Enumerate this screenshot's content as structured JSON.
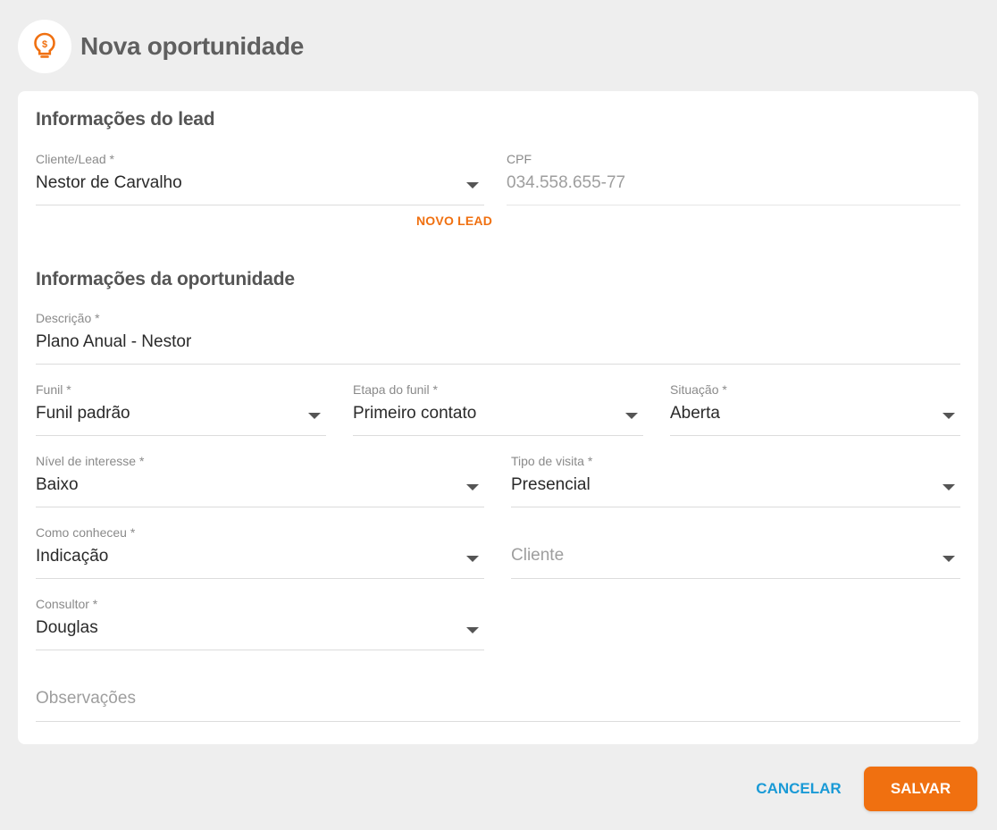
{
  "header": {
    "title": "Nova oportunidade",
    "icon": "lightbulb-dollar-icon",
    "accent_color": "#f07010"
  },
  "lead_section": {
    "title": "Informações do lead",
    "cliente": {
      "label": "Cliente/Lead *",
      "value": "Nestor de Carvalho"
    },
    "cpf": {
      "label": "CPF",
      "value": "034.558.655-77"
    },
    "novo_lead_label": "NOVO LEAD"
  },
  "opportunity_section": {
    "title": "Informações da oportunidade",
    "descricao": {
      "label": "Descrição *",
      "value": "Plano Anual - Nestor"
    },
    "funil": {
      "label": "Funil *",
      "value": "Funil padrão"
    },
    "etapa": {
      "label": "Etapa do funil *",
      "value": "Primeiro contato"
    },
    "situacao": {
      "label": "Situação *",
      "value": "Aberta"
    },
    "nivel_interesse": {
      "label": "Nível de interesse *",
      "value": "Baixo"
    },
    "tipo_visita": {
      "label": "Tipo de visita *",
      "value": "Presencial"
    },
    "como_conheceu": {
      "label": "Como conheceu *",
      "value": "Indicação"
    },
    "cliente_indicador": {
      "placeholder": "Cliente"
    },
    "consultor": {
      "label": "Consultor *",
      "value": "Douglas"
    },
    "observacoes": {
      "placeholder": "Observações"
    }
  },
  "footer": {
    "cancel_label": "CANCELAR",
    "save_label": "SALVAR",
    "cancel_color": "#1a9ad6",
    "save_color": "#f07010"
  }
}
